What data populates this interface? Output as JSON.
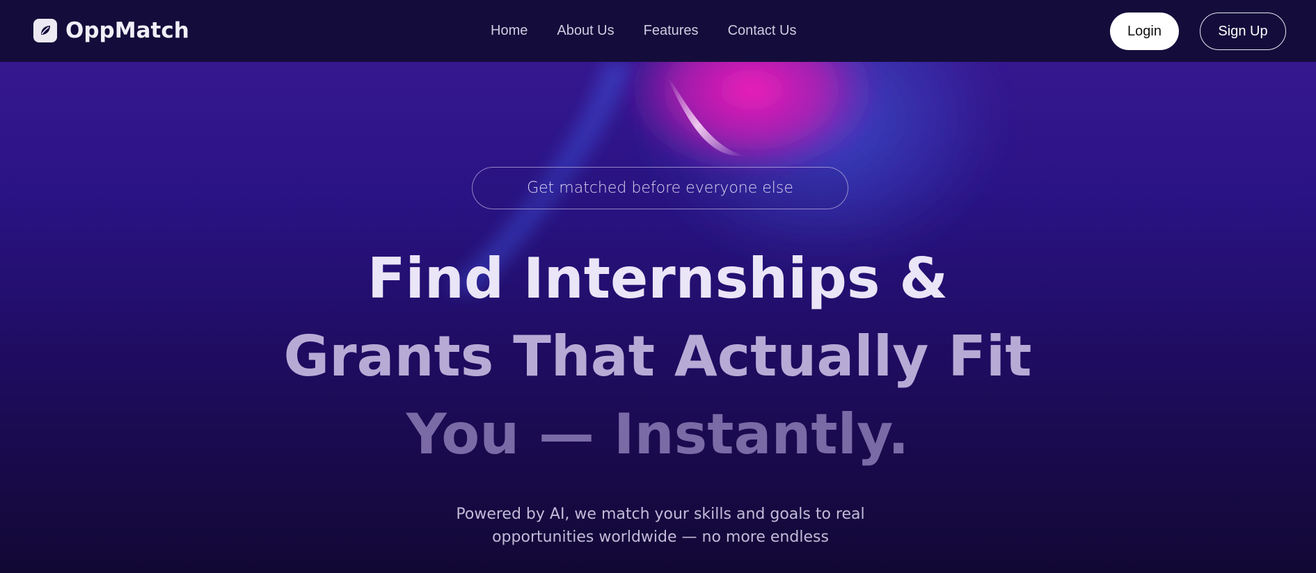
{
  "brand": {
    "name": "OppMatch",
    "logo_icon": "leaf-logo-icon"
  },
  "nav": {
    "items": [
      {
        "label": "Home"
      },
      {
        "label": "About Us"
      },
      {
        "label": "Features"
      },
      {
        "label": "Contact Us"
      }
    ]
  },
  "auth": {
    "login_label": "Login",
    "signup_label": "Sign Up"
  },
  "hero": {
    "badge": "Get matched before everyone else",
    "headline": {
      "line1": "Find Internships &",
      "line2": "Grants That Actually Fit",
      "line3": "You — Instantly."
    },
    "subtext_line1": "Powered by AI, we match your skills and goals to real",
    "subtext_line2": "opportunities worldwide — no more endless"
  },
  "colors": {
    "header_bg": "#140d3b",
    "hero_top": "#36178f",
    "hero_bottom": "#120834",
    "accent_pink": "#e81cb4",
    "accent_blue": "#3b4fd1"
  }
}
